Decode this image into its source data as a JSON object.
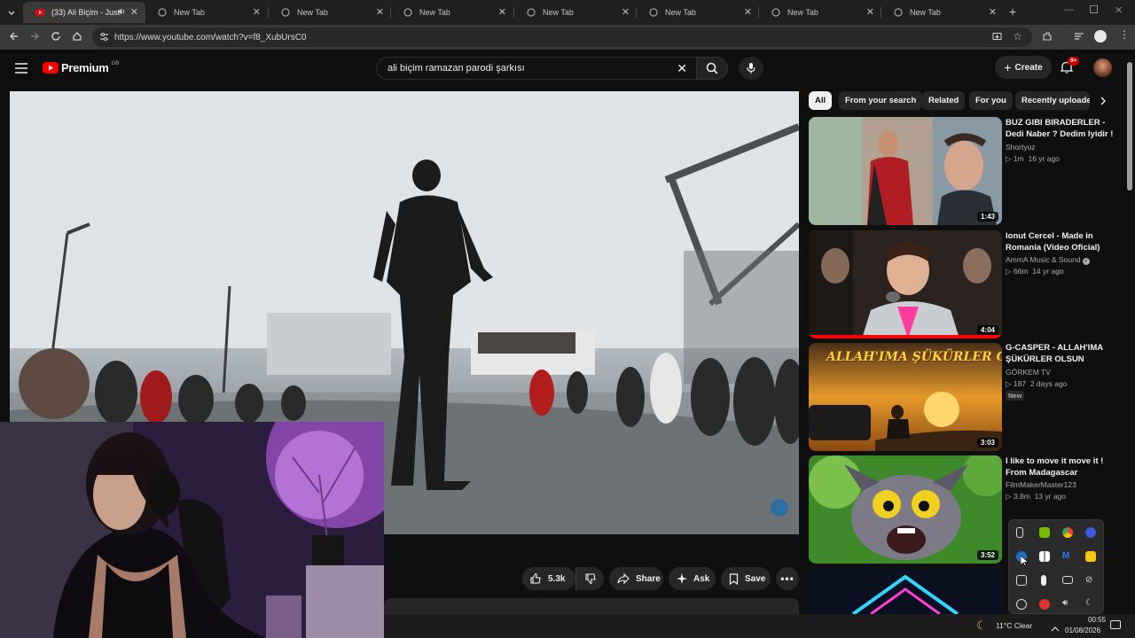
{
  "browser": {
    "tabs": [
      {
        "title": "(33) Ali Biçim - Just Pl",
        "active": true
      },
      {
        "title": "New Tab"
      },
      {
        "title": "New Tab"
      },
      {
        "title": "New Tab"
      },
      {
        "title": "New Tab"
      },
      {
        "title": "New Tab"
      },
      {
        "title": "New Tab"
      },
      {
        "title": "New Tab"
      }
    ],
    "url": "https://www.youtube.com/watch?v=f8_XubUrsC0"
  },
  "youtube": {
    "logo_text": "Premium",
    "region": "GB",
    "search_query": "ali biçim ramazan parodi şarkısı",
    "create_label": "Create",
    "notification_count": "9+"
  },
  "actions": {
    "likes": "5.3k",
    "share": "Share",
    "ask": "Ask",
    "save": "Save"
  },
  "chips": [
    "All",
    "From your search",
    "Related",
    "For you",
    "Recently uploaded"
  ],
  "related": [
    {
      "title": "BUZ GIBI BIRADERLER - Dedi Naber ? Dedim Iyidir !",
      "channel": "Shortyoz",
      "views": "1m",
      "age": "16 yr ago",
      "duration": "1:43",
      "badge": ""
    },
    {
      "title": "Ionut Cercel - Made in Romania (Video Oficial)",
      "channel": "AmmA Music & Sound",
      "views": "66m",
      "age": "14 yr ago",
      "duration": "4:04",
      "badge": ""
    },
    {
      "title": "G-CASPER - ALLAH'IMA ŞÜKÜRLER OLSUN",
      "channel": "GÖRKEM TV",
      "views": "187",
      "age": "2 days ago",
      "duration": "3:03",
      "badge": "New"
    },
    {
      "title": "I like to move it move it ! From Madagascar",
      "channel": "FilmMakerMaster123",
      "views": "3.8m",
      "age": "13 yr ago",
      "duration": "3:52",
      "badge": ""
    }
  ],
  "thumb_texts": {
    "casper": "ALLAH'IMA ŞÜKÜRLER OLSUN"
  },
  "taskbar": {
    "weather": "11°C  Clear",
    "time": "00:55",
    "date": "01/08/2026"
  },
  "colors": {
    "youtube_red": "#ff0000",
    "bg": "#0f0f0f",
    "chip_bg": "#272727"
  }
}
